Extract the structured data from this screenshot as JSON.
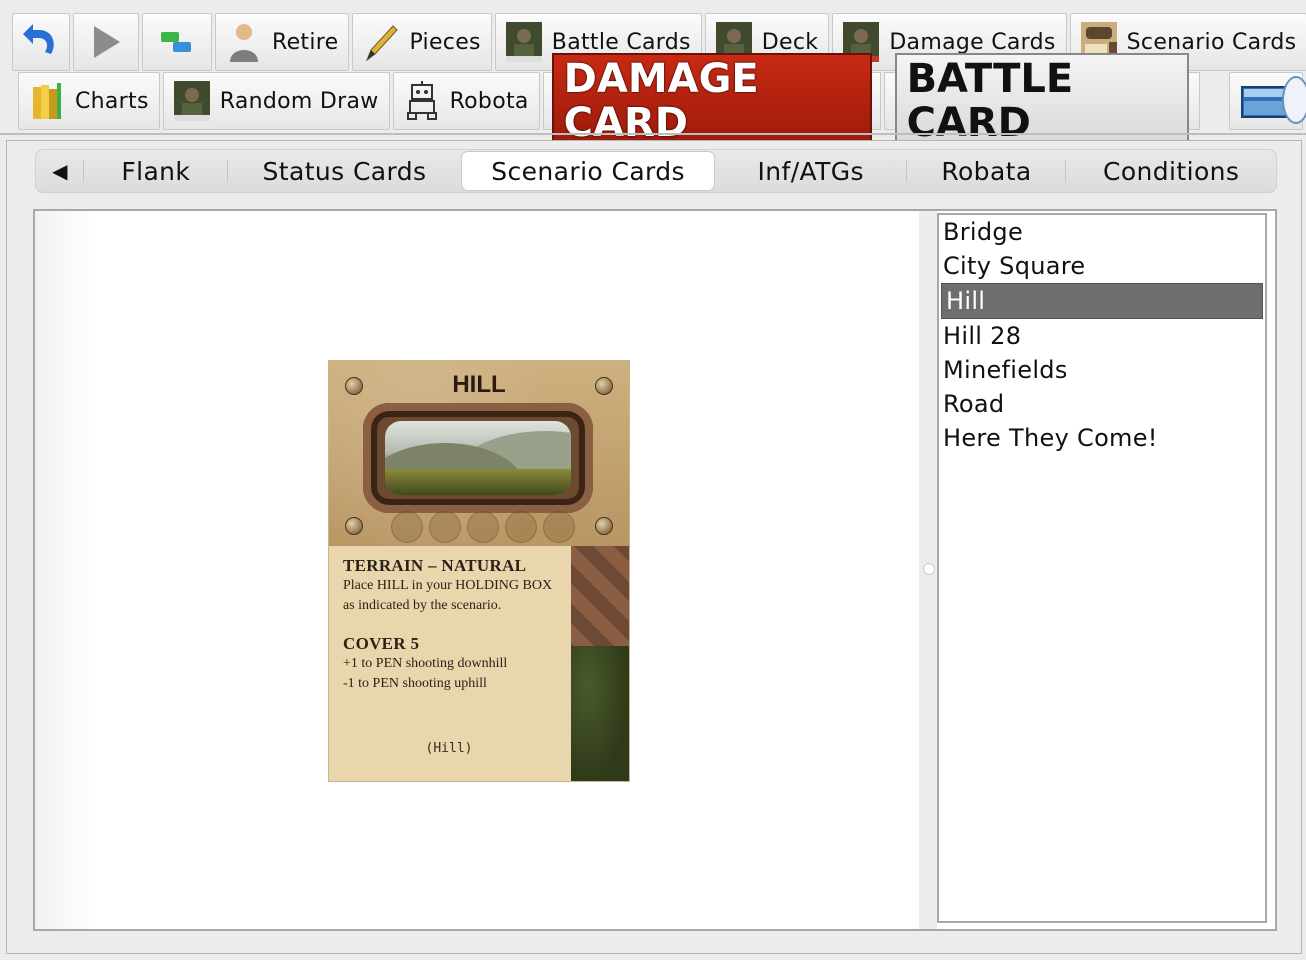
{
  "toolbar1": {
    "retire": "Retire",
    "pieces": "Pieces",
    "battle_cards": "Battle Cards",
    "deck": "Deck",
    "damage_cards": "Damage Cards",
    "scenario_cards": "Scenario Cards"
  },
  "toolbar2": {
    "charts": "Charts",
    "random_draw": "Random Draw",
    "robota": "Robota",
    "damage_card_banner": "DAMAGE CARD",
    "battle_card_banner": "BATTLE CARD"
  },
  "tabs": {
    "items": [
      {
        "label": "Flank"
      },
      {
        "label": "Status Cards"
      },
      {
        "label": "Scenario Cards"
      },
      {
        "label": "Inf/ATGs"
      },
      {
        "label": "Robata"
      },
      {
        "label": "Conditions"
      }
    ],
    "active": "Scenario Cards"
  },
  "list": {
    "items": [
      "Bridge",
      "City Square",
      "Hill",
      "Hill 28",
      "Minefields",
      "Road",
      "Here They Come!"
    ],
    "selected": "Hill"
  },
  "card": {
    "title": "HILL",
    "heading1": "TERRAIN – NATURAL",
    "text1_line1": "Place HILL in your HOLDING BOX",
    "text1_line2": "as indicated by the scenario.",
    "heading2": "COVER 5",
    "text2_line1": "+1 to PEN shooting downhill",
    "text2_line2": "-1 to PEN shooting uphill",
    "footer": "(Hill)"
  },
  "colors": {
    "damage_banner": "#b52210",
    "list_selection": "#6e6e6e",
    "undo_blue": "#2b6fd6"
  }
}
